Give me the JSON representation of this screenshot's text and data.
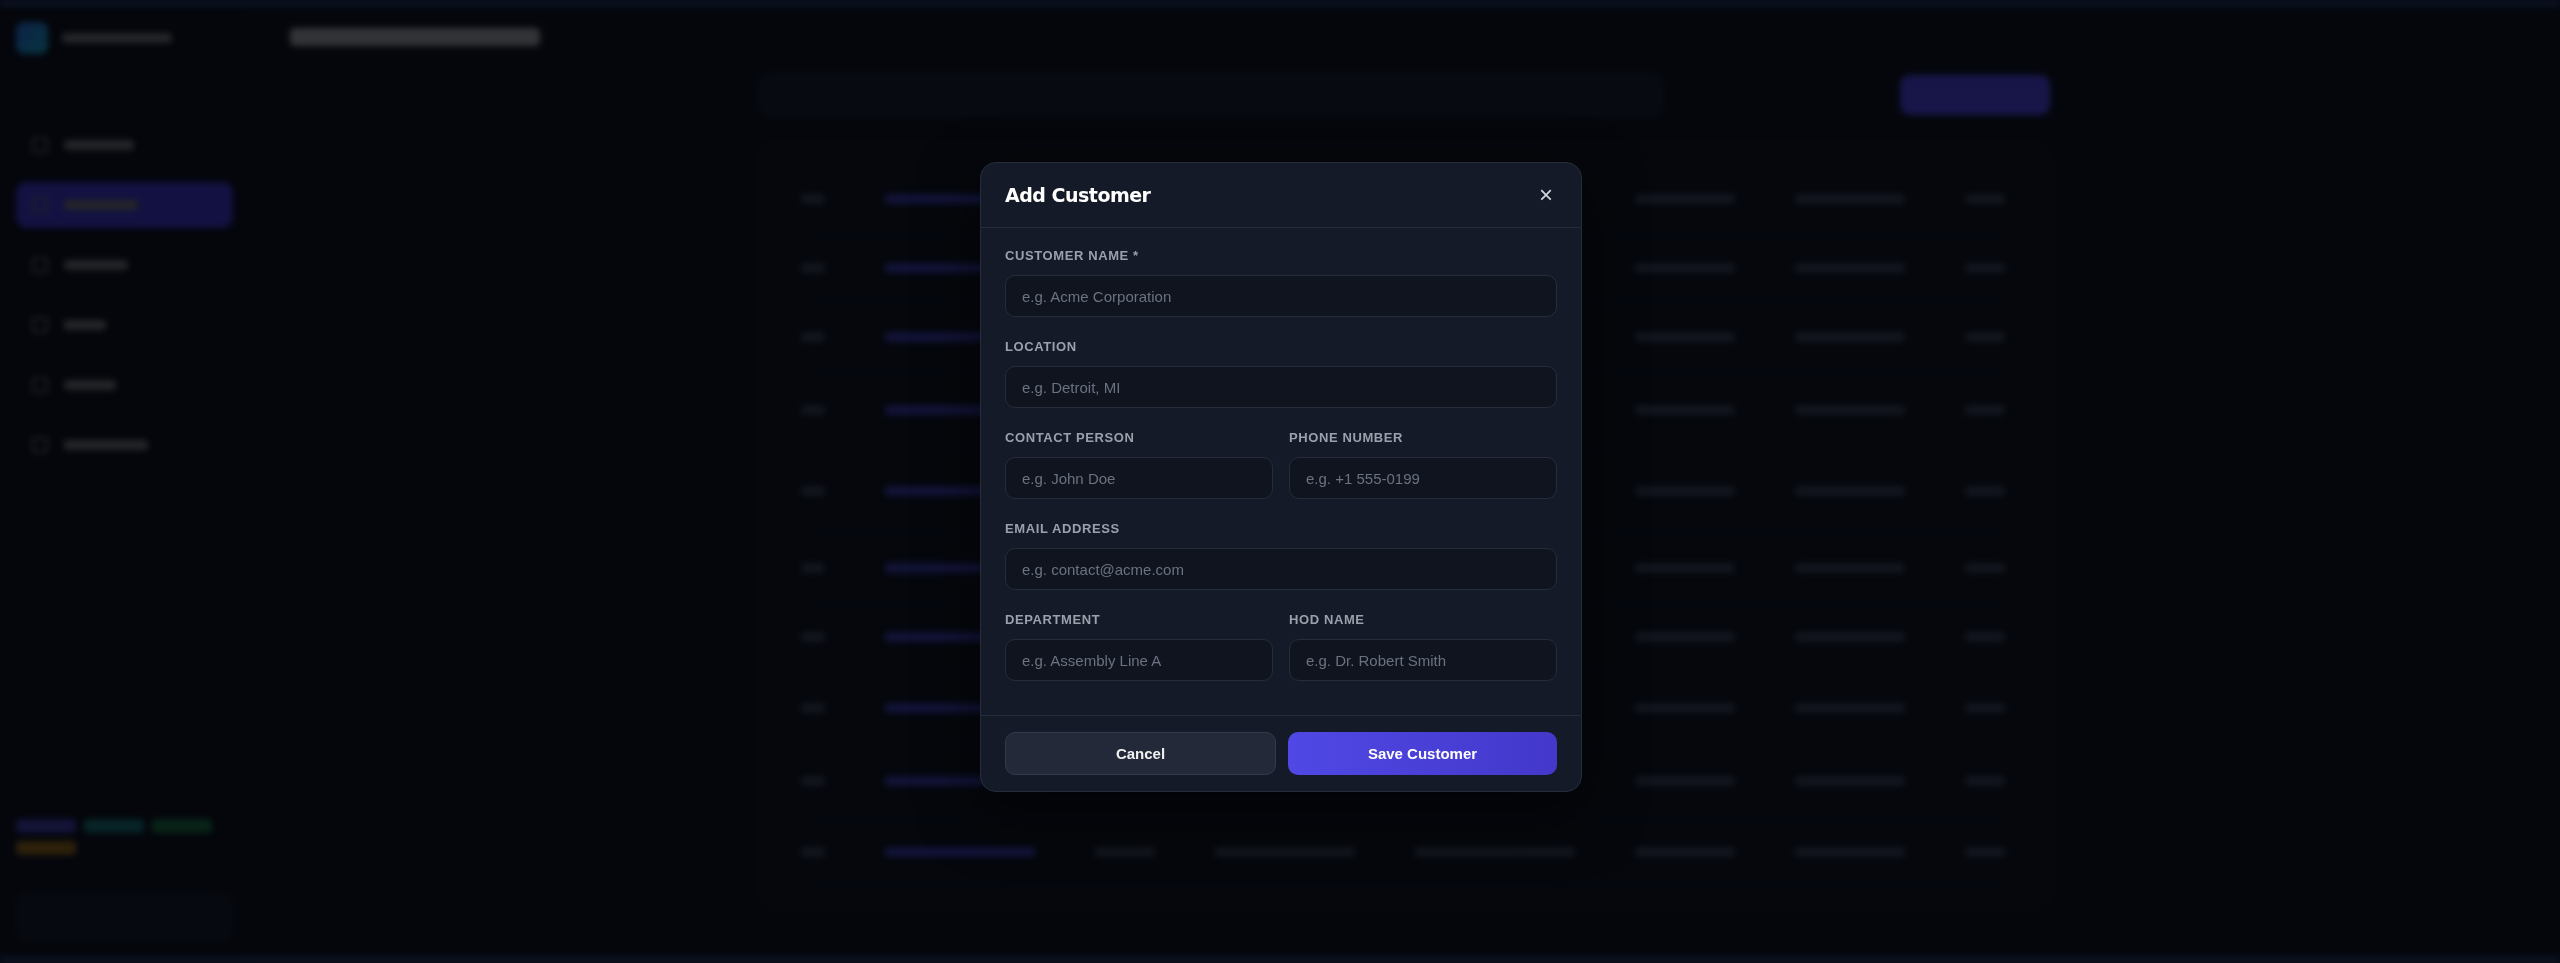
{
  "modal": {
    "title": "Add Customer",
    "close": "×",
    "rows": [
      [
        {
          "label": "CUSTOMER NAME *",
          "placeholder": "e.g. Acme Corporation"
        }
      ],
      [
        {
          "label": "LOCATION",
          "placeholder": "e.g. Detroit, MI"
        }
      ],
      [
        {
          "label": "CONTACT PERSON",
          "placeholder": "e.g. John Doe"
        },
        {
          "label": "PHONE NUMBER",
          "placeholder": "e.g. +1 555-0199"
        }
      ],
      [
        {
          "label": "EMAIL ADDRESS",
          "placeholder": "e.g. contact@acme.com"
        }
      ],
      [
        {
          "label": "DEPARTMENT",
          "placeholder": "e.g. Assembly Line A"
        },
        {
          "label": "HOD NAME",
          "placeholder": "e.g. Dr. Robert Smith"
        }
      ]
    ],
    "buttons": [
      {
        "label": "Cancel",
        "kind": "secondary"
      },
      {
        "label": "Save Customer",
        "kind": "primary"
      }
    ]
  }
}
